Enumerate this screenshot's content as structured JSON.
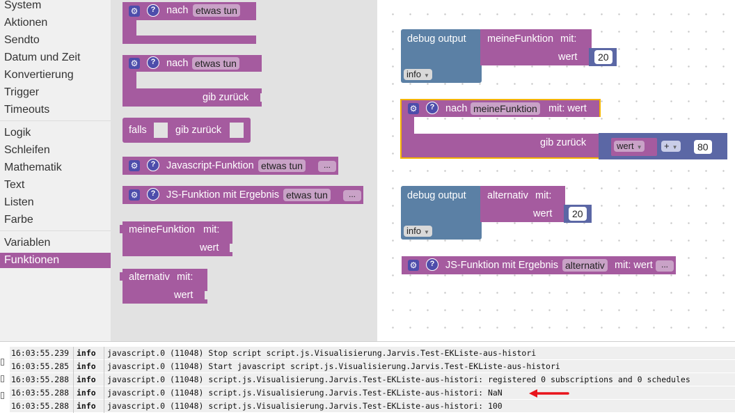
{
  "toolbox": {
    "categories": [
      "System",
      "Aktionen",
      "Sendto",
      "Datum und Zeit",
      "Konvertierung",
      "Trigger",
      "Timeouts",
      "Logik",
      "Schleifen",
      "Mathematik",
      "Text",
      "Listen",
      "Farbe",
      "Variablen",
      "Funktionen"
    ],
    "selected": "Funktionen"
  },
  "flyout": {
    "proc_noreturn": {
      "label": "nach",
      "name": "etwas tun"
    },
    "proc_return": {
      "label": "nach",
      "name": "etwas tun",
      "return_label": "gib zurück"
    },
    "ifreturn": {
      "if_label": "falls",
      "return_label": "gib zurück"
    },
    "js_func": {
      "label": "Javascript-Funktion",
      "name": "etwas tun",
      "more": "..."
    },
    "js_func_result": {
      "label": "JS-Funktion mit Ergebnis",
      "name": "etwas tun",
      "more": "..."
    },
    "call_meine": {
      "name": "meineFunktion",
      "with": "mit:",
      "param": "wert"
    },
    "call_alt": {
      "name": "alternativ",
      "with": "mit:",
      "param": "wert"
    }
  },
  "workspace": {
    "debug1": {
      "label": "debug output",
      "call_name": "meineFunktion",
      "with": "mit:",
      "param": "wert",
      "value": "20",
      "level": "info"
    },
    "func_def": {
      "label": "nach",
      "name": "meineFunktion",
      "with": "mit: wert",
      "return_label": "gib zurück",
      "var": "wert",
      "op": "+",
      "num": "80"
    },
    "debug2": {
      "label": "debug output",
      "call_name": "alternativ",
      "with": "mit:",
      "param": "wert",
      "value": "20",
      "level": "info"
    },
    "js_result": {
      "label": "JS-Funktion mit Ergebnis",
      "name": "alternativ",
      "with": "mit: wert",
      "more": "..."
    }
  },
  "log": {
    "rows": [
      {
        "time": "16:03:55.239",
        "level": "info",
        "msg": "javascript.0 (11048) Stop script script.js.Visualisierung.Jarvis.Test-EKListe-aus-histori"
      },
      {
        "time": "16:03:55.285",
        "level": "info",
        "msg": "javascript.0 (11048) Start javascript script.js.Visualisierung.Jarvis.Test-EKListe-aus-histori"
      },
      {
        "time": "16:03:55.288",
        "level": "info",
        "msg": "javascript.0 (11048) script.js.Visualisierung.Jarvis.Test-EKListe-aus-histori: registered 0 subscriptions and 0 schedules"
      },
      {
        "time": "16:03:55.288",
        "level": "info",
        "msg": "javascript.0 (11048) script.js.Visualisierung.Jarvis.Test-EKListe-aus-histori: NaN"
      },
      {
        "time": "16:03:55.288",
        "level": "info",
        "msg": "javascript.0 (11048) script.js.Visualisierung.Jarvis.Test-EKListe-aus-histori: 100"
      }
    ]
  },
  "colors": {
    "procedure": "#a55b9f",
    "debug": "#5b80a5",
    "math": "#5b67a5",
    "selected_category": "#a55b9f",
    "annotation_arrow": "#e8141c"
  }
}
